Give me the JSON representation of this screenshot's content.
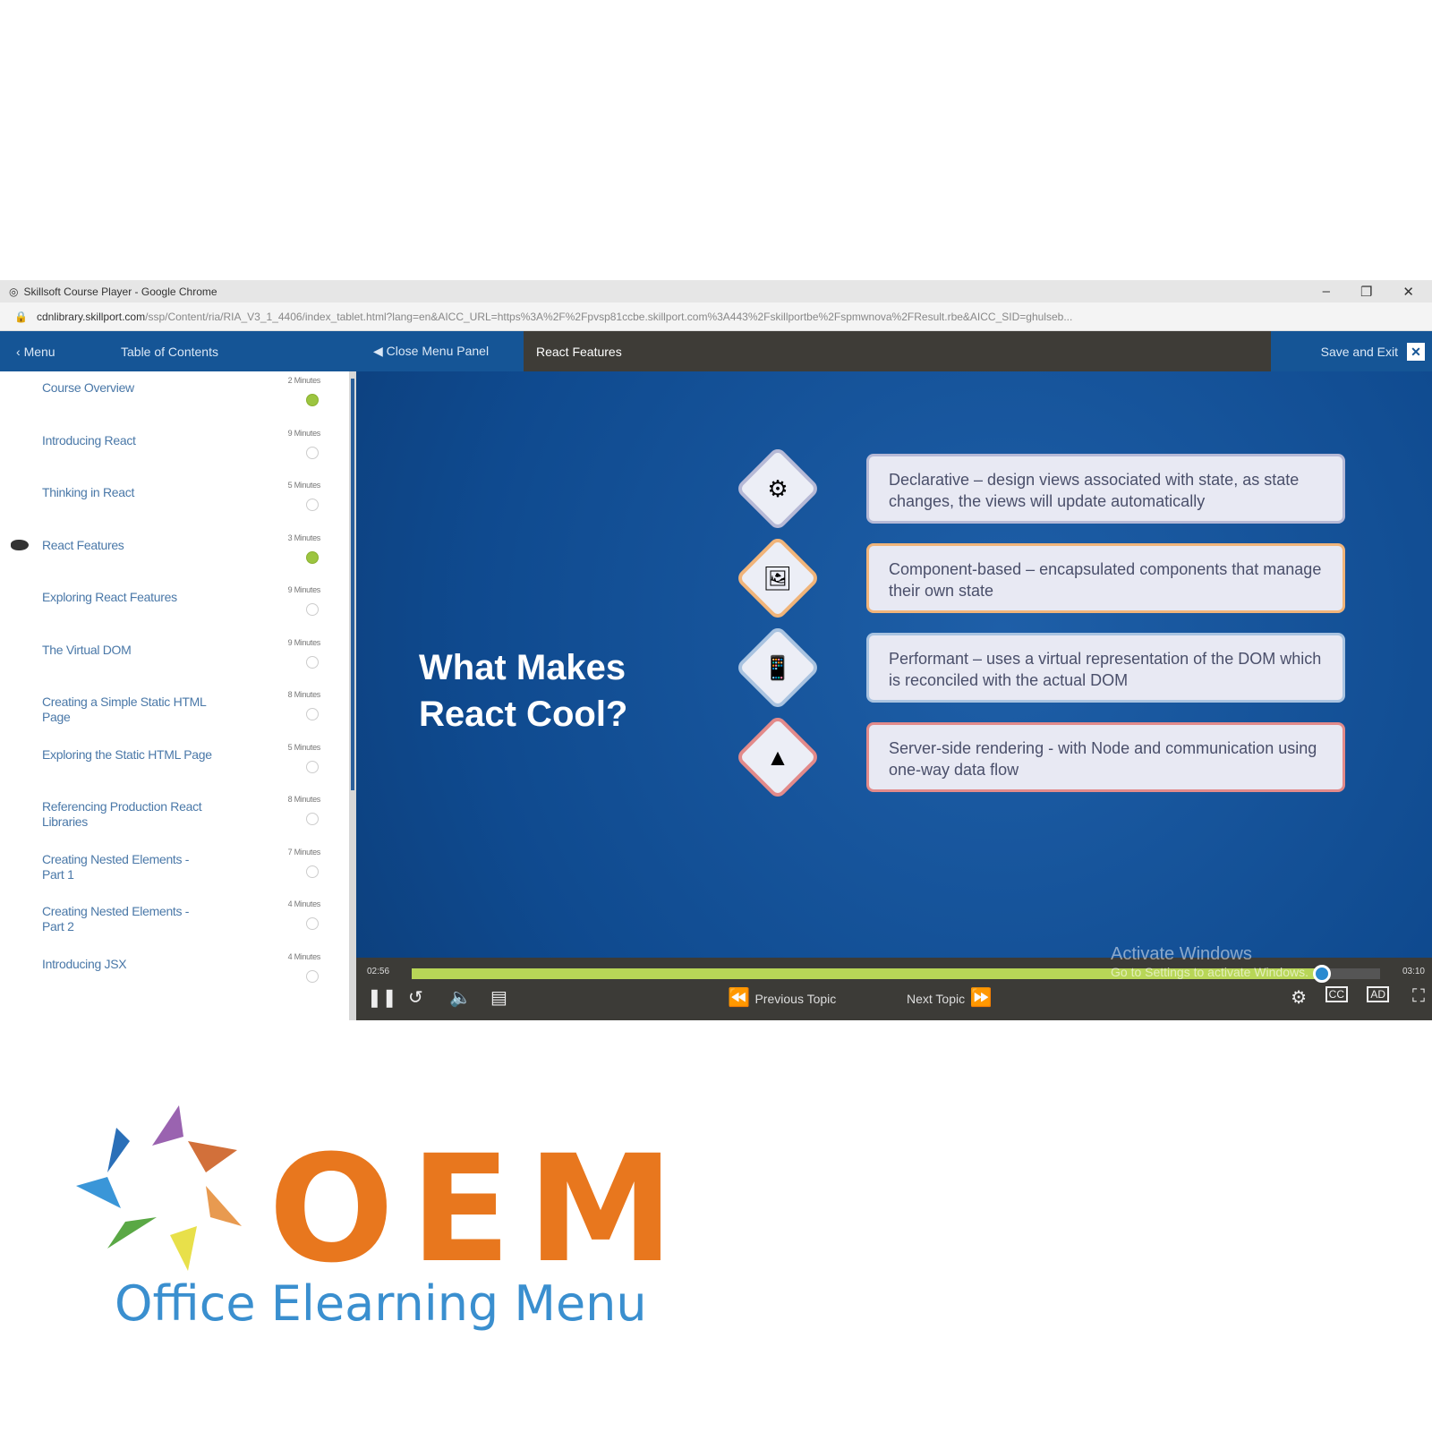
{
  "browser": {
    "title": "Skillsoft Course Player - Google Chrome",
    "url_domain": "cdnlibrary.skillport.com",
    "url_path": "/ssp/Content/ria/RIA_V3_1_4406/index_tablet.html?lang=en&AICC_URL=https%3A%2F%2Fpvsp81ccbe.skillport.com%3A443%2Fskillportbe%2Fspmwnova%2FResult.rbe&AICC_SID=ghulseb..."
  },
  "header": {
    "menu": "Menu",
    "toc": "Table of Contents",
    "close_panel": "Close Menu Panel",
    "current": "React Features",
    "save_exit": "Save and Exit"
  },
  "toc": [
    {
      "title": "Course Overview",
      "minutes": "2 Minutes",
      "done": true
    },
    {
      "title": "Introducing React",
      "minutes": "9 Minutes",
      "done": false
    },
    {
      "title": "Thinking in React",
      "minutes": "5 Minutes",
      "done": false
    },
    {
      "title": "React Features",
      "minutes": "3 Minutes",
      "done": true,
      "current": true
    },
    {
      "title": "Exploring React Features",
      "minutes": "9 Minutes",
      "done": false
    },
    {
      "title": "The Virtual DOM",
      "minutes": "9 Minutes",
      "done": false
    },
    {
      "title": "Creating a Simple Static HTML Page",
      "minutes": "8 Minutes",
      "done": false
    },
    {
      "title": "Exploring the Static HTML Page",
      "minutes": "5 Minutes",
      "done": false
    },
    {
      "title": "Referencing Production React Libraries",
      "minutes": "8 Minutes",
      "done": false
    },
    {
      "title": "Creating Nested Elements - Part 1",
      "minutes": "7 Minutes",
      "done": false
    },
    {
      "title": "Creating Nested Elements - Part 2",
      "minutes": "4 Minutes",
      "done": false
    },
    {
      "title": "Introducing JSX",
      "minutes": "4 Minutes",
      "done": false
    }
  ],
  "slide": {
    "title_line1": "What Makes",
    "title_line2": "React Cool?",
    "features": [
      {
        "text": "Declarative – design views associated with state, as state changes, the views will update automatically",
        "icon": "gears-icon",
        "color": "#b6b9d6"
      },
      {
        "text": "Component-based – encapsulated components that manage their own state",
        "icon": "image-icon",
        "color": "#f0b47a"
      },
      {
        "text": "Performant – uses a virtual representation of the DOM which is reconciled with the actual DOM",
        "icon": "mobile-icon",
        "color": "#a9c3e0"
      },
      {
        "text": "Server-side rendering - with Node and communication using one-way data flow",
        "icon": "pyramid-icon",
        "color": "#e28a8a"
      }
    ]
  },
  "player": {
    "elapsed": "02:56",
    "total": "03:10",
    "progress": 0.94,
    "previous": "Previous Topic",
    "next": "Next Topic",
    "watermark1": "Activate Windows",
    "watermark2": "Go to Settings to activate Windows."
  },
  "brand": {
    "name": "OEM",
    "tagline": "Office Elearning Menu"
  }
}
